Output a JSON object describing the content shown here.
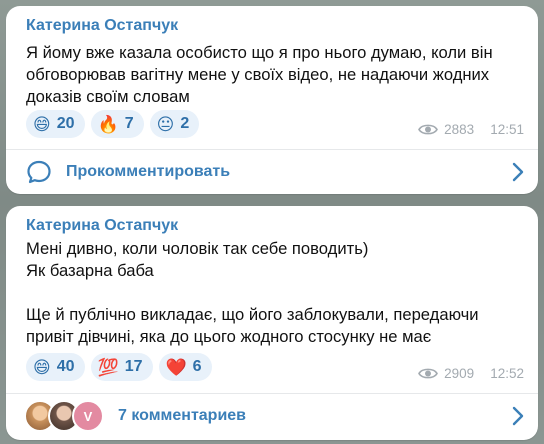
{
  "messages": [
    {
      "sender": "Катерина Остапчук",
      "text": "Я йому вже казала особисто що я про нього думаю, коли він\nобговорював вагітну мене у своїх відео, не надаючи жодних\nдоказів своїм словам",
      "reactions": [
        {
          "emoji": "😄",
          "count": "20"
        },
        {
          "emoji": "🔥",
          "count": "7"
        },
        {
          "emoji": "😐",
          "count": "2"
        }
      ],
      "views": "2883",
      "time": "12:51",
      "footer_label": "Прокомментировать",
      "footer_icon": "comment-icon"
    },
    {
      "sender": "Катерина Остапчук",
      "text": "Мені дивно, коли чоловік так себе поводить)\nЯк базарна баба\n\nЩе й публічно викладає, що його заблокували, передаючи\nпривіт дівчині, яка до цього жодного стосунку не має",
      "reactions": [
        {
          "emoji": "😄",
          "count": "40"
        },
        {
          "emoji": "💯",
          "count": "17"
        },
        {
          "emoji": "❤️",
          "count": "6"
        }
      ],
      "views": "2909",
      "time": "12:52",
      "footer_label": "7 комментариев",
      "avatar_letter": "V"
    }
  ],
  "colors": {
    "accent": "#3b7fb8",
    "reaction_bg": "#e8f1fa",
    "meta": "#a3aab0"
  }
}
